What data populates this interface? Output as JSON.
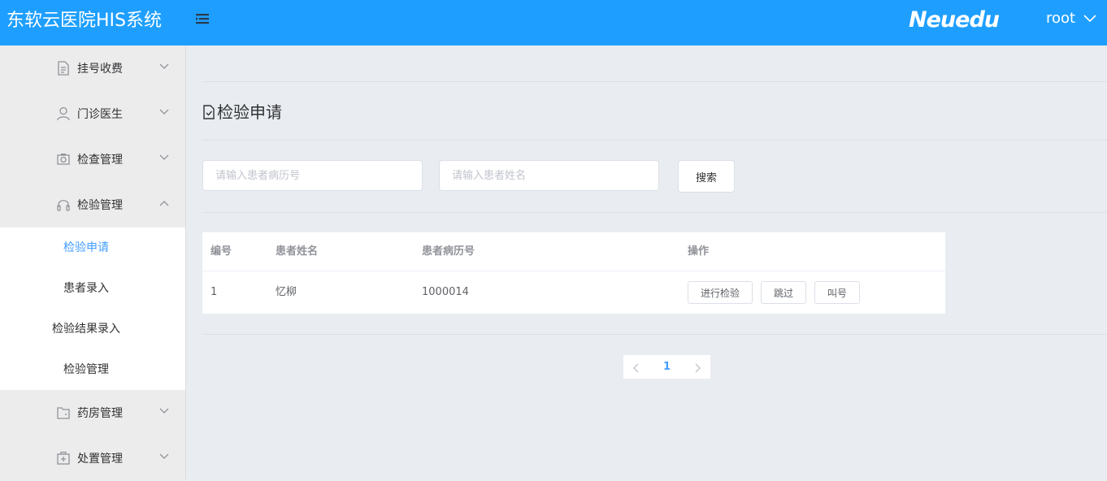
{
  "header": {
    "app_title": "东软云医院HIS系统",
    "brand": "Neuedu",
    "user": "root"
  },
  "sidebar": {
    "menus": [
      {
        "label": "挂号收费",
        "icon": "document-icon"
      },
      {
        "label": "门诊医生",
        "icon": "user-icon"
      },
      {
        "label": "检查管理",
        "icon": "camera-icon"
      },
      {
        "label": "检验管理",
        "icon": "headset-icon",
        "expanded": true
      },
      {
        "label": "药房管理",
        "icon": "wallet-icon"
      },
      {
        "label": "处置管理",
        "icon": "first-aid-icon"
      }
    ],
    "submenu": [
      {
        "label": "检验申请",
        "active": true
      },
      {
        "label": "患者录入"
      },
      {
        "label": "检验结果录入"
      },
      {
        "label": "检验管理"
      }
    ]
  },
  "page": {
    "title": "检验申请",
    "search": {
      "record_placeholder": "请输入患者病历号",
      "name_placeholder": "请输入患者姓名",
      "button": "搜索"
    },
    "table": {
      "columns": [
        "编号",
        "患者姓名",
        "患者病历号",
        "操作"
      ],
      "rows": [
        {
          "id": "1",
          "name": "忆柳",
          "record_no": "1000014",
          "actions": [
            "进行检验",
            "跳过",
            "叫号"
          ]
        }
      ]
    },
    "pagination": {
      "current": "1"
    }
  },
  "colors": {
    "header_bg": "#1e9fff",
    "active": "#409eff",
    "sidebar_bg": "#ececec",
    "main_bg": "#e9edf1"
  }
}
